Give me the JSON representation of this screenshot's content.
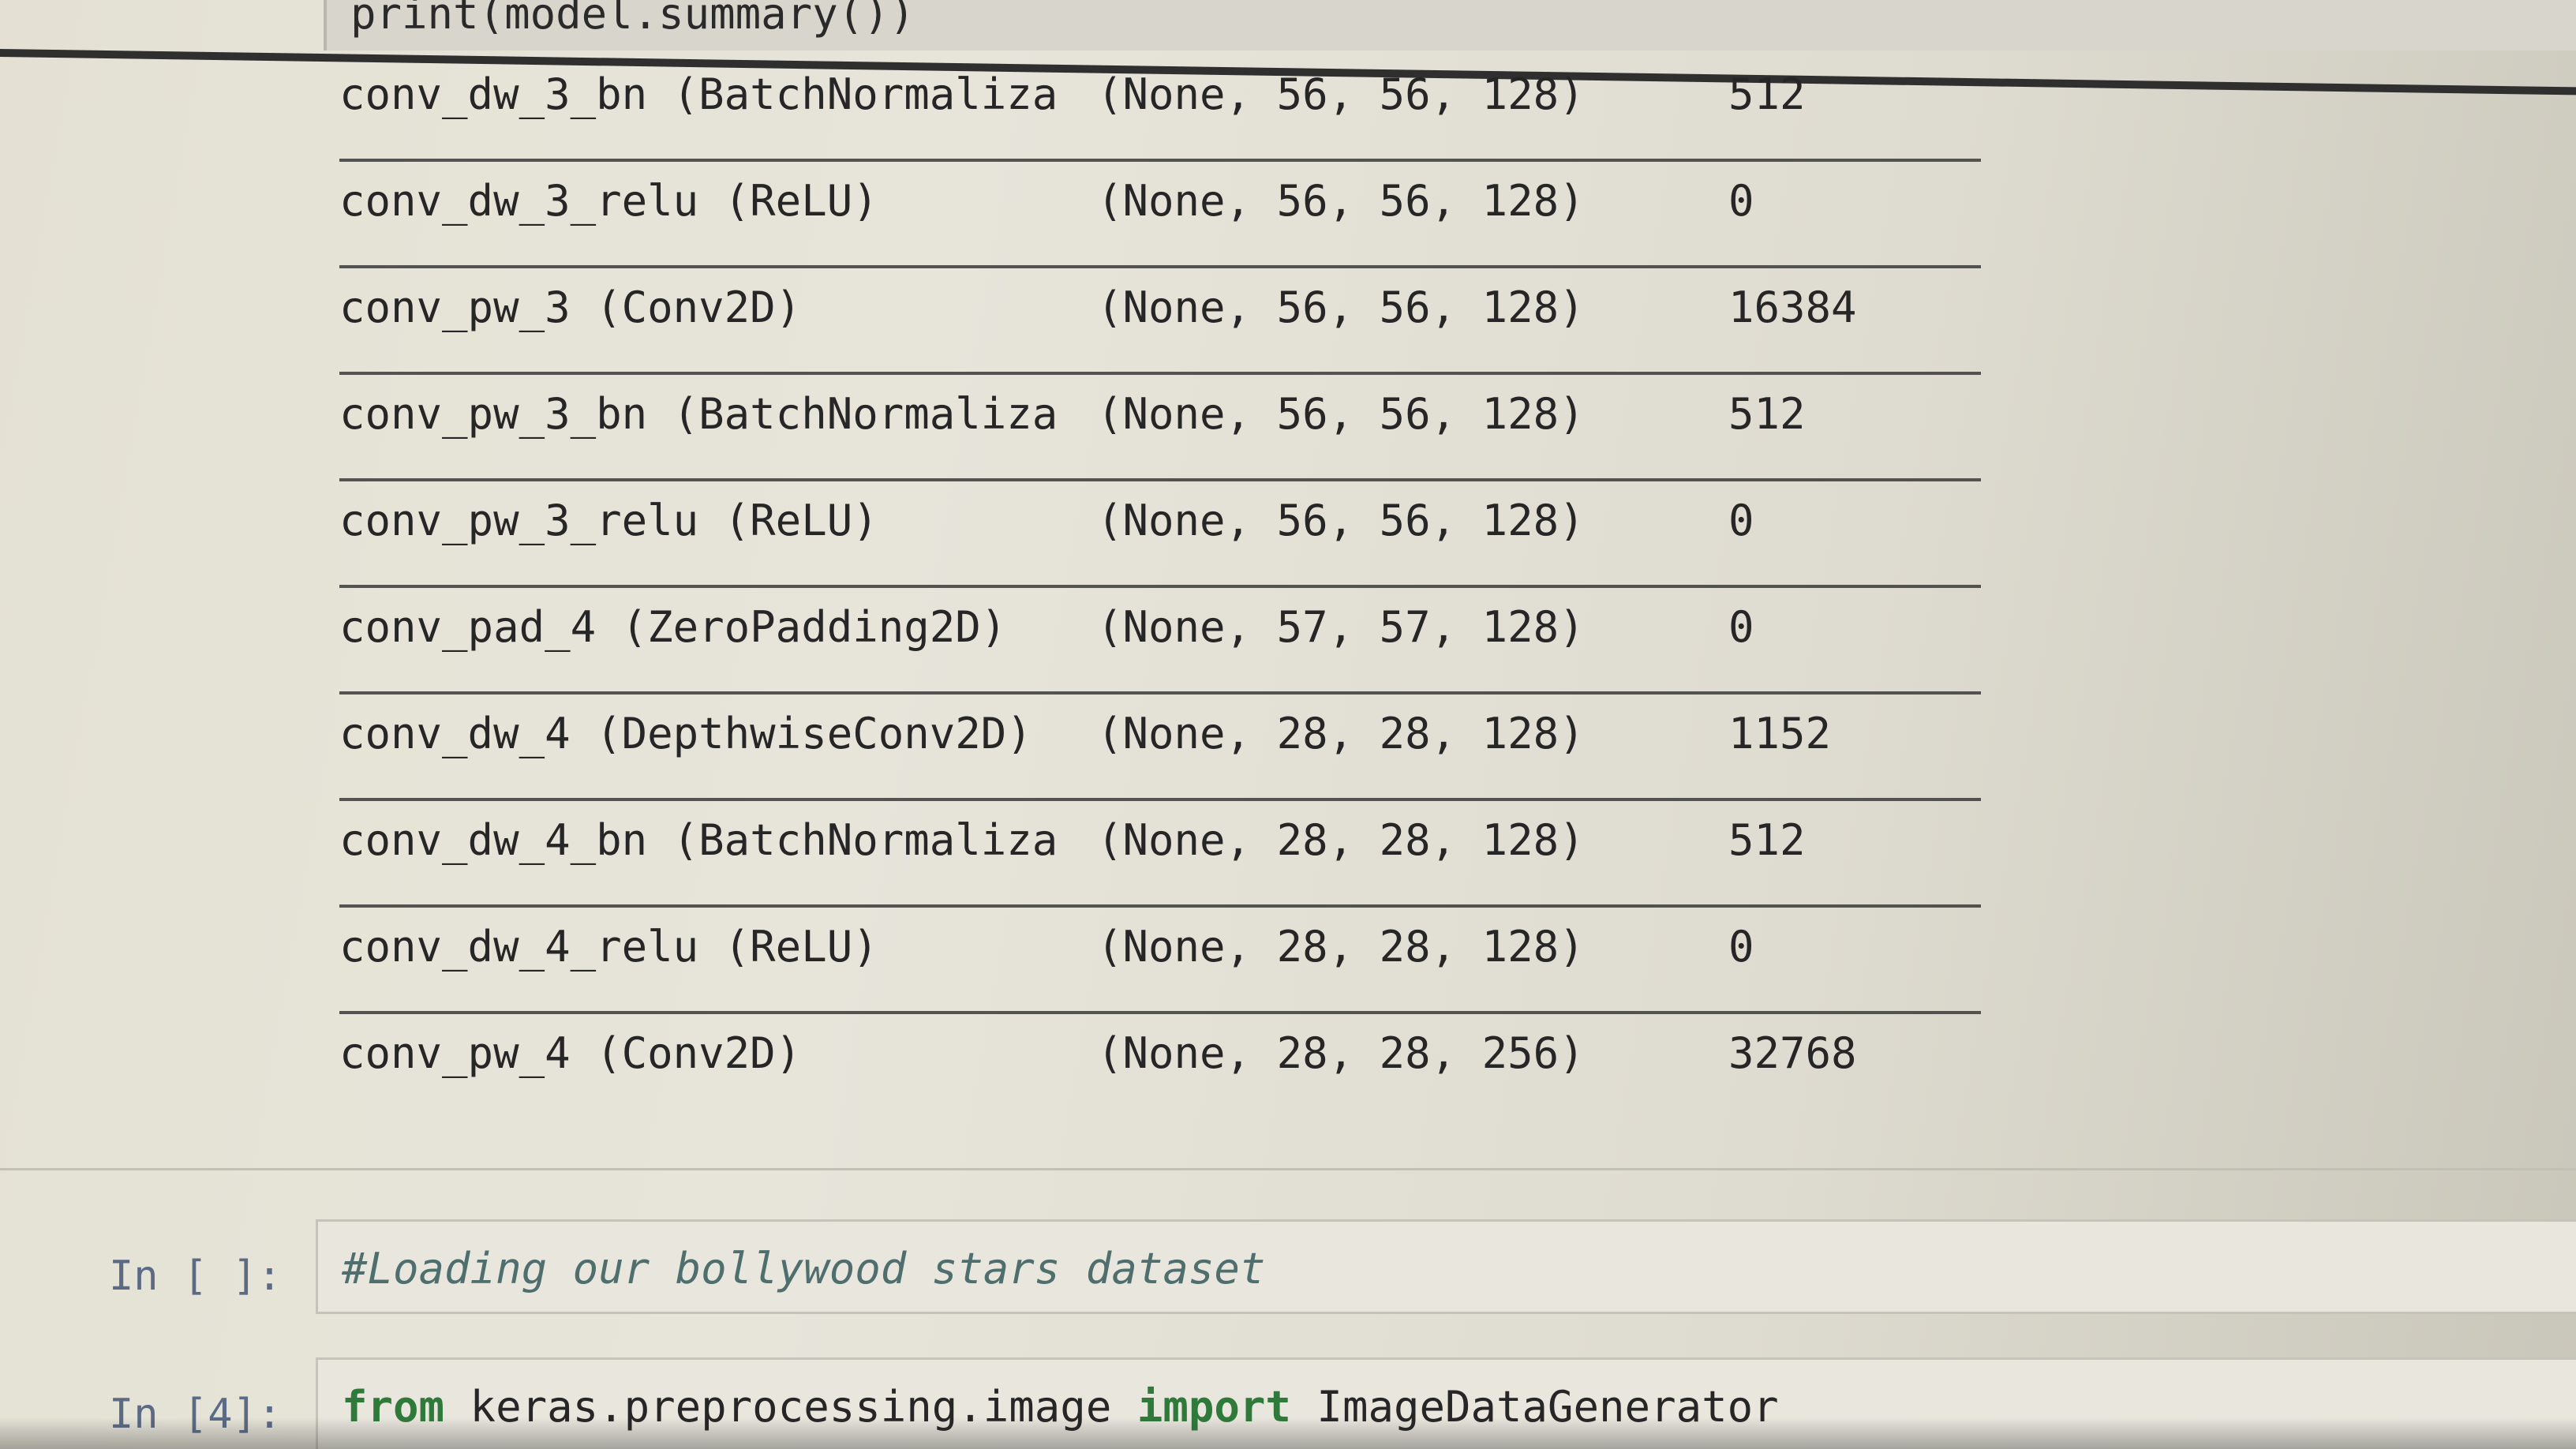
{
  "top_cell": {
    "code": "print(model.summary())"
  },
  "summary_rows": [
    {
      "name": "conv_dw_3_bn (BatchNormaliza",
      "shape": "(None, 56, 56, 128)",
      "params": "512"
    },
    {
      "name": "conv_dw_3_relu (ReLU)",
      "shape": "(None, 56, 56, 128)",
      "params": "0"
    },
    {
      "name": "conv_pw_3 (Conv2D)",
      "shape": "(None, 56, 56, 128)",
      "params": "16384"
    },
    {
      "name": "conv_pw_3_bn (BatchNormaliza",
      "shape": "(None, 56, 56, 128)",
      "params": "512"
    },
    {
      "name": "conv_pw_3_relu (ReLU)",
      "shape": "(None, 56, 56, 128)",
      "params": "0"
    },
    {
      "name": "conv_pad_4 (ZeroPadding2D)",
      "shape": "(None, 57, 57, 128)",
      "params": "0"
    },
    {
      "name": "conv_dw_4 (DepthwiseConv2D)",
      "shape": "(None, 28, 28, 128)",
      "params": "1152"
    },
    {
      "name": "conv_dw_4_bn (BatchNormaliza",
      "shape": "(None, 28, 28, 128)",
      "params": "512"
    },
    {
      "name": "conv_dw_4_relu (ReLU)",
      "shape": "(None, 28, 28, 128)",
      "params": "0"
    },
    {
      "name": "conv_pw_4 (Conv2D)",
      "shape": "(None, 28, 28, 256)",
      "params": "32768"
    }
  ],
  "cells": [
    {
      "prompt": "In [ ]:",
      "code": "#Loading our bollywood stars dataset"
    },
    {
      "prompt": "In [4]:",
      "code_keyword_from": "from",
      "code_module": " keras.preprocessing.image ",
      "code_keyword_import": "import",
      "code_name": " ImageDataGenerator"
    }
  ]
}
